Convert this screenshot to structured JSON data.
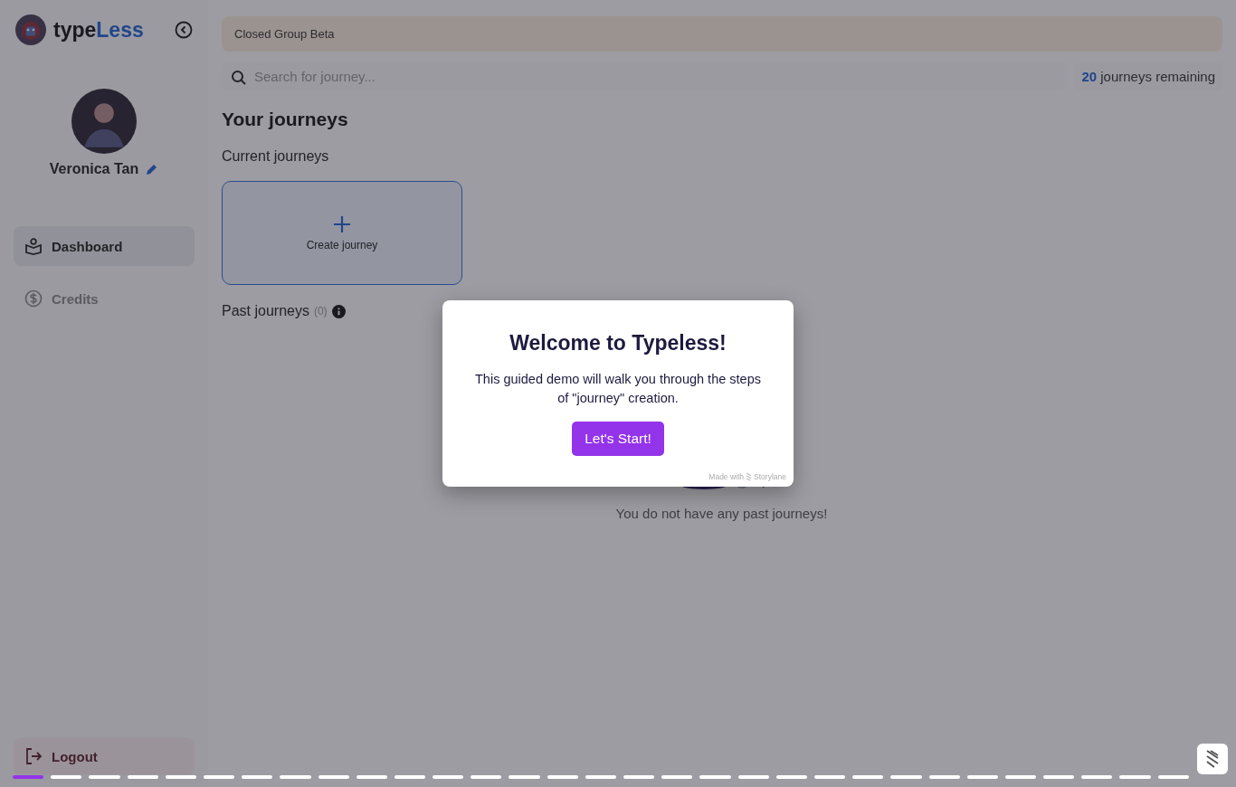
{
  "sidebar": {
    "logo": {
      "prefix": "type",
      "suffix": "Less"
    },
    "user": {
      "name": "Veronica Tan"
    },
    "nav": [
      {
        "label": "Dashboard",
        "selected": true
      },
      {
        "label": "Credits",
        "selected": false
      }
    ],
    "logout": "Logout"
  },
  "banner": "Closed Group Beta",
  "search": {
    "placeholder": "Search for journey..."
  },
  "remaining": {
    "count": "20",
    "label": "journeys remaining"
  },
  "heading": "Your journeys",
  "current": {
    "title": "Current journeys",
    "create": "Create journey"
  },
  "past": {
    "title": "Past journeys",
    "count": "(0)",
    "empty": "You do not have any past journeys!"
  },
  "modal": {
    "title": "Welcome to Typeless!",
    "body": "This guided demo will walk you through the steps of \"journey\" creation.",
    "button": "Let's Start!",
    "credit_prefix": "Made with",
    "credit_brand": "Storylane"
  },
  "progress": [
    {
      "current": true
    },
    {
      "current": false
    },
    {
      "current": false
    },
    {
      "current": false
    },
    {
      "current": false
    },
    {
      "current": false
    },
    {
      "current": false
    },
    {
      "current": false
    },
    {
      "current": false
    },
    {
      "current": false
    },
    {
      "current": false
    },
    {
      "current": false
    },
    {
      "current": false
    },
    {
      "current": false
    },
    {
      "current": false
    },
    {
      "current": false
    },
    {
      "current": false
    },
    {
      "current": false
    },
    {
      "current": false
    },
    {
      "current": false
    },
    {
      "current": false
    },
    {
      "current": false
    },
    {
      "current": false
    },
    {
      "current": false
    },
    {
      "current": false
    },
    {
      "current": false
    },
    {
      "current": false
    },
    {
      "current": false
    },
    {
      "current": false
    },
    {
      "current": false
    },
    {
      "current": false
    }
  ]
}
